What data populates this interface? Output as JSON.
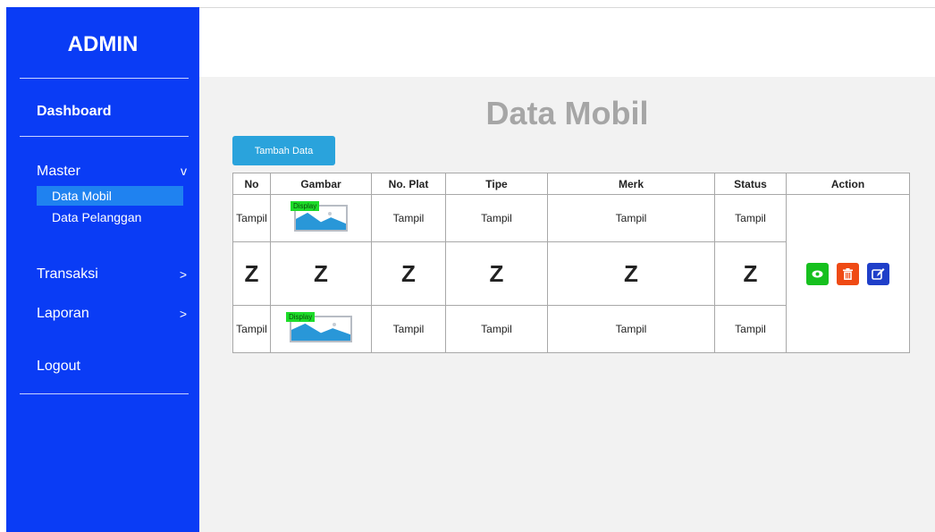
{
  "sidebar": {
    "brand": "ADMIN",
    "dashboard": "Dashboard",
    "master": {
      "label": "Master",
      "chevron": "v"
    },
    "sub_items": [
      "Data Mobil",
      "Data Pelanggan"
    ],
    "transaksi": {
      "label": "Transaksi",
      "chevron": ">"
    },
    "laporan": {
      "label": "Laporan",
      "chevron": ">"
    },
    "logout": "Logout"
  },
  "main": {
    "title": "Data Mobil",
    "add_button": "Tambah Data"
  },
  "table": {
    "headers": [
      "No",
      "Gambar",
      "No. Plat",
      "Tipe",
      "Merk",
      "Status",
      "Action"
    ],
    "rows": [
      [
        "Tampil",
        "Tampil",
        "Tampil",
        "Tampil",
        "Tampil"
      ],
      [
        "Z",
        "Z",
        "Z",
        "Z",
        "Z",
        "Z"
      ],
      [
        "Tampil",
        "Tampil",
        "Tampil",
        "Tampil",
        "Tampil"
      ]
    ],
    "image_tag": "Display",
    "actions": [
      {
        "name": "view",
        "icon": "eye-icon",
        "color": "#16c01e"
      },
      {
        "name": "delete",
        "icon": "trash-icon",
        "color": "#ef4a14"
      },
      {
        "name": "edit",
        "icon": "edit-icon",
        "color": "#1f3fc9"
      }
    ]
  },
  "colors": {
    "sidebar": "#0a3cf5",
    "active_item": "#1f82f0",
    "add_button": "#2aa3dc",
    "title": "#a6a6a6"
  }
}
